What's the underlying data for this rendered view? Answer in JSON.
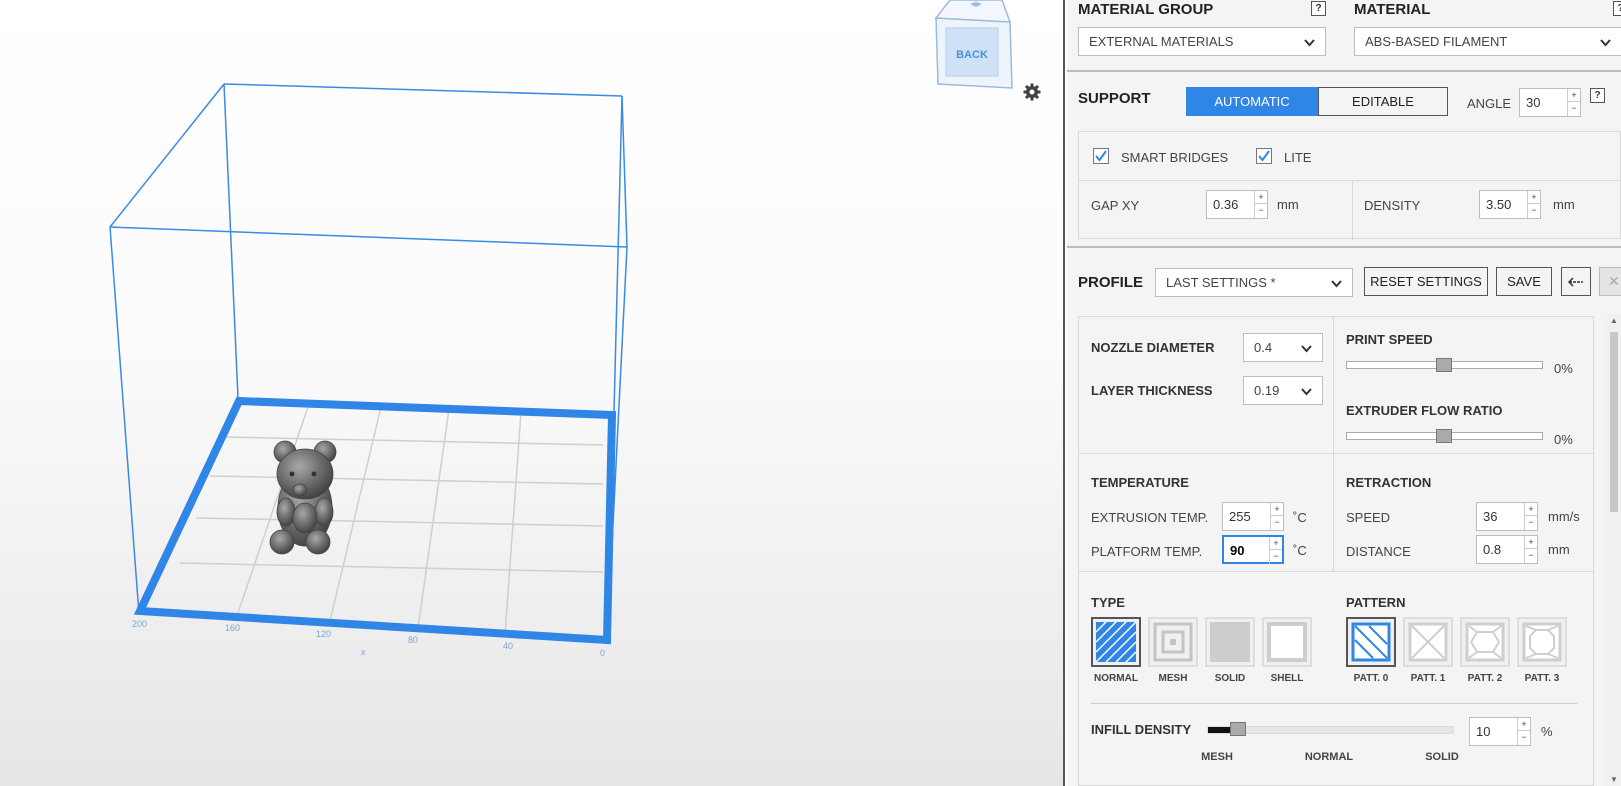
{
  "viewport": {
    "view_cube_label": "BACK",
    "axis_ticks": [
      "200",
      "160",
      "120",
      "80",
      "40",
      "0"
    ],
    "axis_name": "x"
  },
  "material": {
    "group_label": "MATERIAL GROUP",
    "group_value": "EXTERNAL MATERIALS",
    "material_label": "MATERIAL",
    "material_value": "ABS-BASED FILAMENT",
    "help": "?"
  },
  "support": {
    "label": "SUPPORT",
    "automatic": "AUTOMATIC",
    "editable": "EDITABLE",
    "angle_label": "ANGLE",
    "angle_value": "30",
    "help": "?",
    "smart_bridges": "SMART BRIDGES",
    "lite": "LITE",
    "gap_xy_label": "GAP XY",
    "gap_xy_value": "0.36",
    "gap_unit": "mm",
    "density_label": "DENSITY",
    "density_value": "3.50",
    "density_unit": "mm"
  },
  "profile": {
    "label": "PROFILE",
    "value": "LAST SETTINGS *",
    "reset": "RESET SETTINGS",
    "save": "SAVE",
    "nozzle_label": "NOZZLE DIAMETER",
    "nozzle_value": "0.4",
    "layer_label": "LAYER THICKNESS",
    "layer_value": "0.19",
    "print_speed_label": "PRINT SPEED",
    "print_speed_value": "0%",
    "flow_label": "EXTRUDER FLOW RATIO",
    "flow_value": "0%",
    "temperature_label": "TEMPERATURE",
    "extrusion_label": "EXTRUSION TEMP.",
    "extrusion_value": "255",
    "platform_label": "PLATFORM TEMP.",
    "platform_value": "90",
    "deg_unit": "˚C",
    "retraction_label": "RETRACTION",
    "speed_label": "SPEED",
    "speed_value": "36",
    "speed_unit": "mm/s",
    "distance_label": "DISTANCE",
    "distance_value": "0.8",
    "distance_unit": "mm",
    "type_label": "TYPE",
    "types": [
      "NORMAL",
      "MESH",
      "SOLID",
      "SHELL"
    ],
    "pattern_label": "PATTERN",
    "patterns": [
      "PATT. 0",
      "PATT. 1",
      "PATT. 2",
      "PATT. 3"
    ],
    "infill_label": "INFILL DENSITY",
    "infill_value": "10",
    "infill_unit": "%",
    "infill_marks": [
      "MESH",
      "NORMAL",
      "SOLID"
    ]
  },
  "colors": {
    "accent": "#2f86e6",
    "box_line": "#3a8ae6"
  }
}
